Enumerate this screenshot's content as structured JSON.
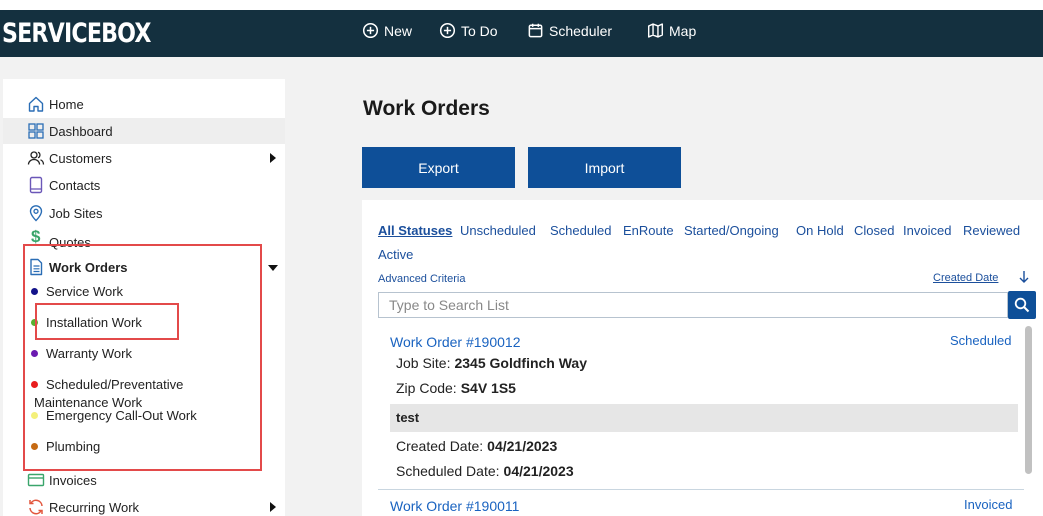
{
  "app": {
    "logo": "SERVICEBOX"
  },
  "topnav": [
    {
      "label": "New",
      "icon": "plus-circle-icon"
    },
    {
      "label": "To Do",
      "icon": "plus-circle-icon"
    },
    {
      "label": "Scheduler",
      "icon": "calendar-icon"
    },
    {
      "label": "Map",
      "icon": "map-icon"
    }
  ],
  "sidebar": {
    "items": [
      {
        "label": "Home",
        "icon": "home-icon"
      },
      {
        "label": "Dashboard",
        "icon": "dashboard-icon"
      },
      {
        "label": "Customers",
        "icon": "users-icon"
      },
      {
        "label": "Contacts",
        "icon": "book-icon"
      },
      {
        "label": "Job Sites",
        "icon": "location-pin-icon"
      },
      {
        "label": "Quotes",
        "icon": "dollar-icon"
      },
      {
        "label": "Work Orders",
        "icon": "document-icon"
      },
      {
        "label": "Invoices",
        "icon": "card-icon"
      },
      {
        "label": "Recurring Work",
        "icon": "refresh-icon"
      }
    ],
    "work_order_types": [
      {
        "label": "Service Work",
        "color": "#13138a"
      },
      {
        "label": "Installation Work",
        "color": "#58b030"
      },
      {
        "label": "Warranty Work",
        "color": "#6b1ab0"
      },
      {
        "label": "Scheduled/Preventative",
        "label2": "Maintenance Work",
        "color": "#e81d1d"
      },
      {
        "label": "Emergency Call-Out Work",
        "color": "#f4f07a"
      },
      {
        "label": "Plumbing",
        "color": "#c66a12"
      }
    ]
  },
  "main": {
    "title": "Work Orders",
    "export_label": "Export",
    "import_label": "Import",
    "statuses": [
      "All Statuses",
      "Unscheduled",
      "Scheduled",
      "EnRoute",
      "Started/Ongoing",
      "On Hold",
      "Closed",
      "Invoiced",
      "Reviewed",
      "Active"
    ],
    "advanced_label": "Advanced Criteria",
    "sort_label": "Created Date",
    "search_placeholder": "Type to Search List",
    "orders": [
      {
        "title": "Work Order #190012",
        "status": "Scheduled",
        "job_site_label": "Job Site:",
        "job_site": "2345 Goldfinch Way",
        "zip_label": "Zip Code:",
        "zip": "S4V 1S5",
        "note": "test",
        "created_label": "Created Date:",
        "created": "04/21/2023",
        "scheduled_label": "Scheduled Date:",
        "scheduled": "04/21/2023"
      },
      {
        "title": "Work Order #190011",
        "status": "Invoiced"
      }
    ]
  },
  "colors": {
    "topbar": "#14303f",
    "accent": "#0e4f98",
    "link": "#1b4f9c",
    "highlight": "#e34a4a"
  }
}
